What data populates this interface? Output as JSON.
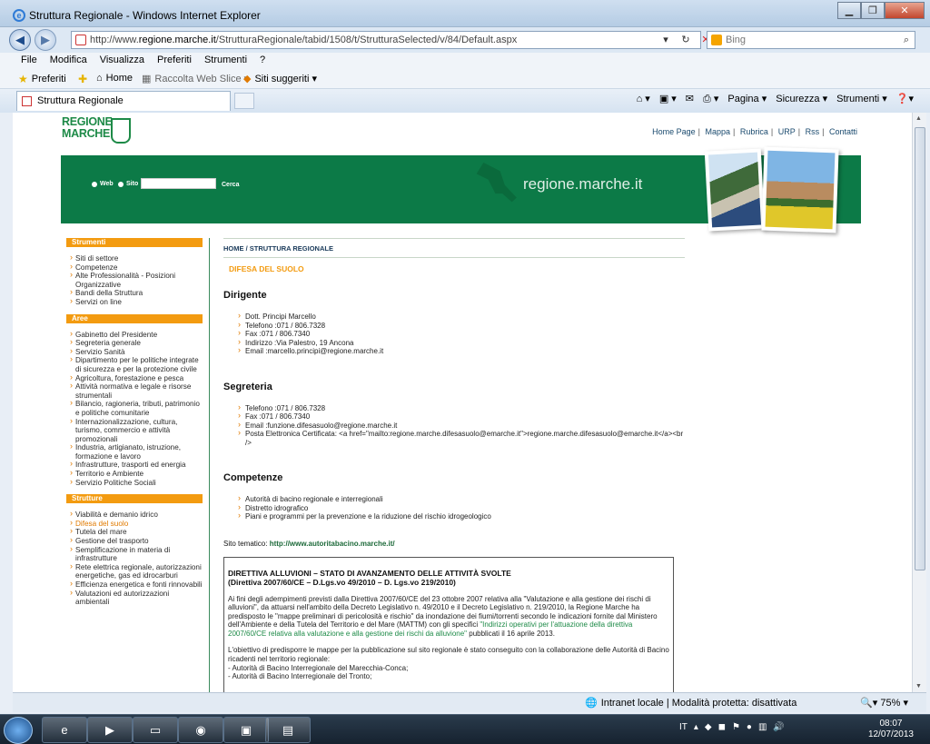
{
  "window": {
    "title": "Struttura Regionale - Windows Internet Explorer"
  },
  "address": {
    "url_prefix": "http://www.",
    "url_domain": "regione.marche.it",
    "url_rest": "/StrutturaRegionale/tabid/1508/t/StrutturaSelected/v/84/Default.aspx",
    "search_placeholder": "Bing"
  },
  "menu": [
    "File",
    "Modifica",
    "Visualizza",
    "Preferiti",
    "Strumenti",
    "?"
  ],
  "favorites": {
    "preferiti": "Preferiti",
    "home": "Home",
    "web_slice": "Raccolta Web Slice ▾",
    "siti": "Siti suggeriti ▾"
  },
  "tab": {
    "label": "Struttura Regionale"
  },
  "commands": {
    "pagina": "Pagina ▾",
    "sicurezza": "Sicurezza ▾",
    "strumenti": "Strumenti ▾"
  },
  "site": {
    "logo_line1": "REGIONE",
    "logo_line2": "MARCHE",
    "toplinks": [
      "Home Page",
      "Mappa",
      "Rubrica",
      "URP",
      "Rss",
      "Contatti"
    ],
    "banner": {
      "web": "Web",
      "sito": "Sito",
      "cerca": "Cerca",
      "name": "regione.marche.it"
    }
  },
  "sidebar": {
    "strumenti_title": "Strumenti",
    "strumenti": [
      "Siti di settore",
      "Competenze",
      "Alte Professionalità - Posizioni Organizzative",
      "Bandi della Struttura",
      "Servizi on line"
    ],
    "aree_title": "Aree",
    "aree": [
      "Gabinetto del Presidente",
      "Segreteria generale",
      "Servizio Sanità",
      "Dipartimento per le politiche integrate di sicurezza e per la protezione civile",
      "Agricoltura, forestazione e pesca",
      "Attività normativa e legale e risorse strumentali",
      "Bilancio, ragioneria, tributi, patrimonio e politiche comunitarie",
      "Internazionalizzazione, cultura, turismo, commercio e attività promozionali",
      "Industria, artigianato, istruzione, formazione e lavoro",
      "Infrastrutture, trasporti ed energia",
      "Territorio e Ambiente",
      "Servizio Politiche Sociali"
    ],
    "strutture_title": "Strutture",
    "strutture": [
      "Viabilità e demanio idrico",
      "Difesa del suolo",
      "Tutela del mare",
      "Gestione del trasporto",
      "Semplificazione in materia di infrastrutture",
      "Rete elettrica regionale, autorizzazioni energetiche, gas ed idrocarburi",
      "Efficienza energetica e fonti rinnovabili",
      "Valutazioni ed autorizzazioni ambientali"
    ]
  },
  "content": {
    "breadcrumb": "HOME / STRUTTURA REGIONALE",
    "title": "DIFESA DEL SUOLO",
    "dirigente_h": "Dirigente",
    "dirigente": [
      "Dott. Principi Marcello",
      "Telefono :071 / 806.7328",
      "Fax :071 / 806.7340",
      "Indirizzo :Via Palestro, 19 Ancona",
      "Email :marcello.principi@regione.marche.it"
    ],
    "segreteria_h": "Segreteria",
    "segreteria": [
      "Telefono :071 / 806.7328",
      "Fax :071 / 806.7340",
      "Email :funzione.difesasuolo@regione.marche.it",
      "Posta Elettronica Certificata: <a href=\"mailto:regione.marche.difesasuolo@emarche.it\">regione.marche.difesasuolo@emarche.it</a><br />"
    ],
    "competenze_h": "Competenze",
    "competenze": [
      "Autorità di bacino regionale e interregionali",
      "Distretto idrografico",
      "Piani e programmi per la prevenzione e la riduzione del rischio idrogeologico"
    ],
    "sito_label": "Sito tematico:",
    "sito_link": "http://www.autoritabacino.marche.it/",
    "box_title1": "DIRETTIVA ALLUVIONI – STATO DI AVANZAMENTO DELLE ATTIVITÀ SVOLTE",
    "box_title2": "(Direttiva 2007/60/CE – D.Lgs.vo 49/2010 – D. Lgs.vo 219/2010)",
    "box_p1_a": "Ai fini degli adempimenti previsti dalla Direttiva 2007/60/CE del 23 ottobre 2007 relativa alla \"Valutazione e alla gestione dei rischi di alluvioni\", da attuarsi nell'ambito della Decreto Legislativo n. 49/2010 e il Decreto Legislativo n. 219/2010, la Regione Marche ha predisposto le \"mappe preliminari di pericolosità e rischio\" da inondazione dei fiumi/torrenti secondo le indicazioni fornite dal Ministero dell'Ambiente e della Tutela del Territorio e del Mare (MATTM) con gli specifici ",
    "box_p1_link": "\"Indirizzi operativi per l'attuazione della direttiva 2007/60/CE relativa alla valutazione e alla gestione dei rischi da alluvione\"",
    "box_p1_b": " pubblicati il 16 aprile 2013.",
    "box_p2": "L'obiettivo di predisporre le mappe per la pubblicazione sul sito regionale è stato conseguito con la collaborazione delle Autorità di Bacino ricadenti nel territorio regionale:",
    "box_p3": "- Autorità di Bacino Interregionale del Marecchia-Conca;",
    "box_p4": "- Autorità di Bacino Interregionale del Tronto;"
  },
  "status": {
    "zone": "Intranet locale | Modalità protetta: disattivata",
    "zoom": "75%"
  },
  "taskbar": {
    "lang": "IT",
    "time": "08:07",
    "date": "12/07/2013"
  }
}
